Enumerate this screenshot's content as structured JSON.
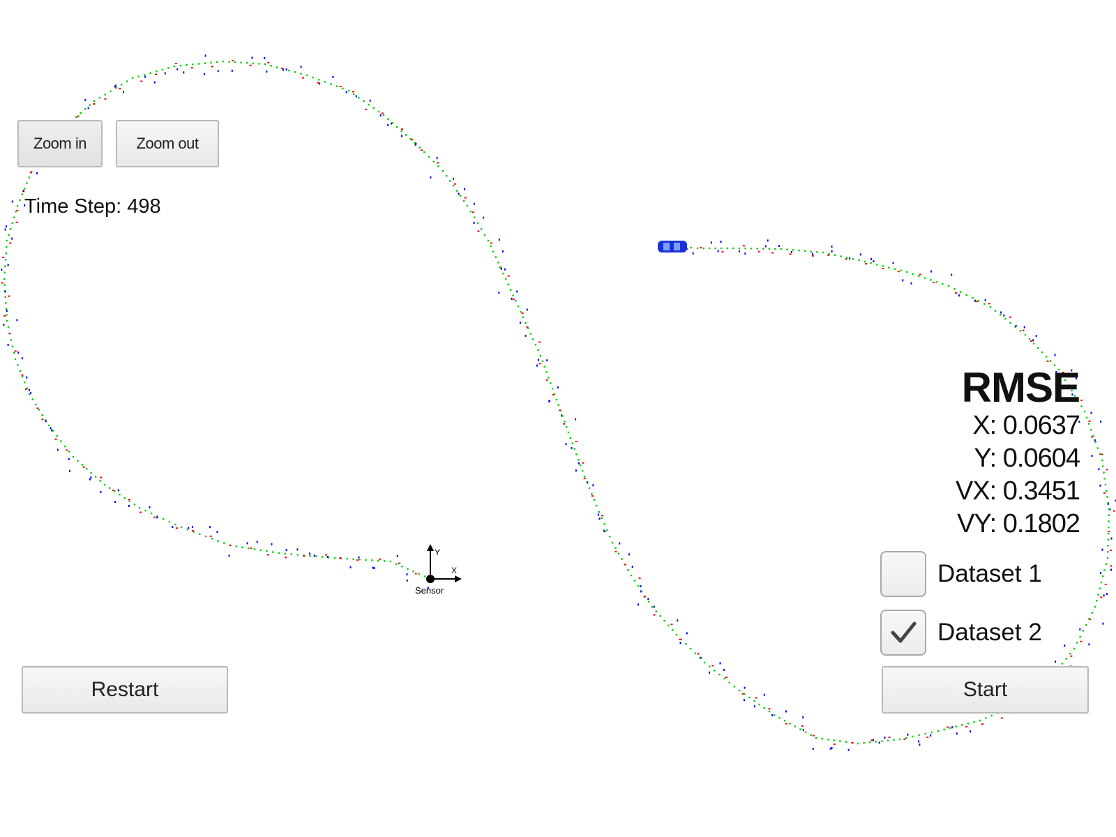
{
  "toolbar": {
    "zoom_in_label": "Zoom in",
    "zoom_out_label": "Zoom out"
  },
  "status": {
    "time_step_label": "Time Step:",
    "time_step_value": "498"
  },
  "rmse": {
    "title": "RMSE",
    "x": "X: 0.0637",
    "y": "Y: 0.0604",
    "vx": "VX: 0.3451",
    "vy": "VY: 0.1802"
  },
  "datasets": [
    {
      "label": "Dataset 1",
      "checked": false
    },
    {
      "label": "Dataset 2",
      "checked": true
    }
  ],
  "controls": {
    "restart_label": "Restart",
    "start_label": "Start"
  },
  "scene": {
    "sensor_label": "Sensor",
    "axis_x_label": "X",
    "axis_y_label": "Y",
    "colors": {
      "estimate": "#00cc00",
      "lidar": "#ff0000",
      "radar": "#0000ff",
      "car": "#1a33d9"
    }
  }
}
